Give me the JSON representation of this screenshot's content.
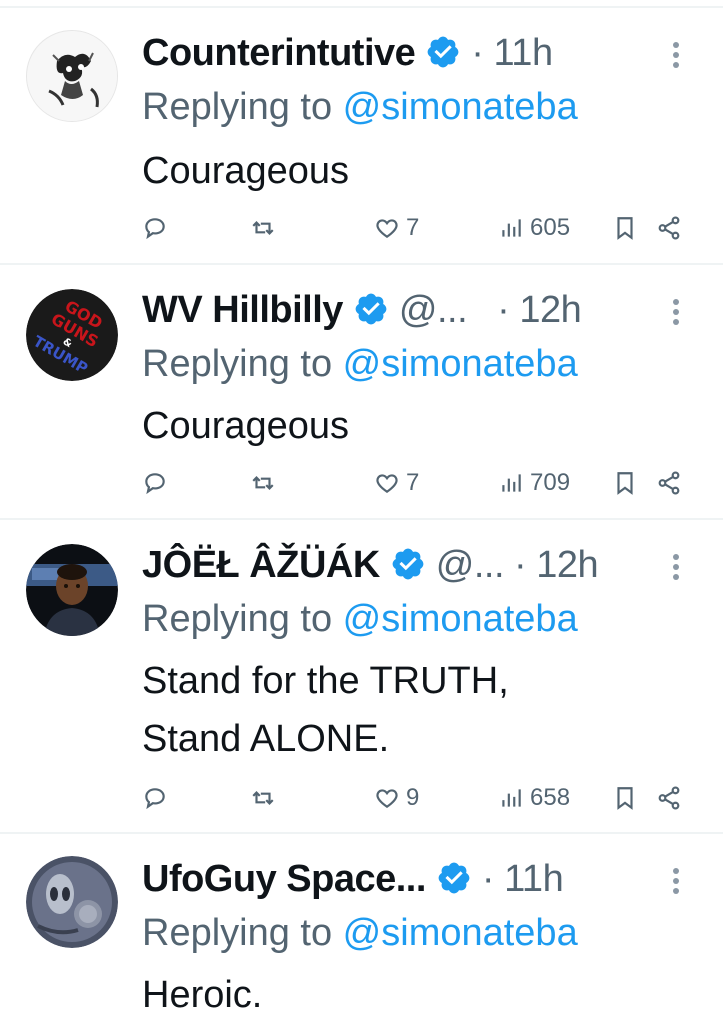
{
  "colors": {
    "accent": "#1d9bf0",
    "muted": "#536471",
    "text": "#0f1419",
    "divider": "#eff3f4"
  },
  "replies": [
    {
      "name": "Counterintutive",
      "handle": "",
      "time": "· 11h",
      "reply_prefix": "Replying to ",
      "reply_mention": "@simonateba",
      "text": "Courageous",
      "likes": "7",
      "views": "605",
      "avatar_icon": "cartoon-sketch-avatar"
    },
    {
      "name": "WV Hillbilly",
      "handle": "@...",
      "time": "· 12h",
      "reply_prefix": "Replying to ",
      "reply_mention": "@simonateba",
      "text": "Courageous",
      "likes": "7",
      "views": "709",
      "avatar_icon": "god-guns-trump-avatar",
      "avatar_text": [
        "GOD",
        "GUNS",
        "&",
        "TRUMP"
      ]
    },
    {
      "name": "JÔËŁ ÂŽÜÁK",
      "handle": "@...",
      "time": "· 12h",
      "reply_prefix": "Replying to ",
      "reply_mention": "@simonateba",
      "text": "Stand for the TRUTH,\nStand ALONE.",
      "likes": "9",
      "views": "658",
      "avatar_icon": "person-photo-avatar"
    },
    {
      "name": "UfoGuy Space...",
      "handle": "",
      "time": "· 11h",
      "reply_prefix": "Replying to ",
      "reply_mention": "@simonateba",
      "text": "Heroic.",
      "avatar_icon": "alien-avatar"
    }
  ],
  "icons": {
    "reply": "reply-icon",
    "retweet": "retweet-icon",
    "like": "heart-icon",
    "views": "views-icon",
    "bookmark": "bookmark-icon",
    "share": "share-icon",
    "verified": "verified-badge-icon",
    "more": "more-options-icon"
  }
}
